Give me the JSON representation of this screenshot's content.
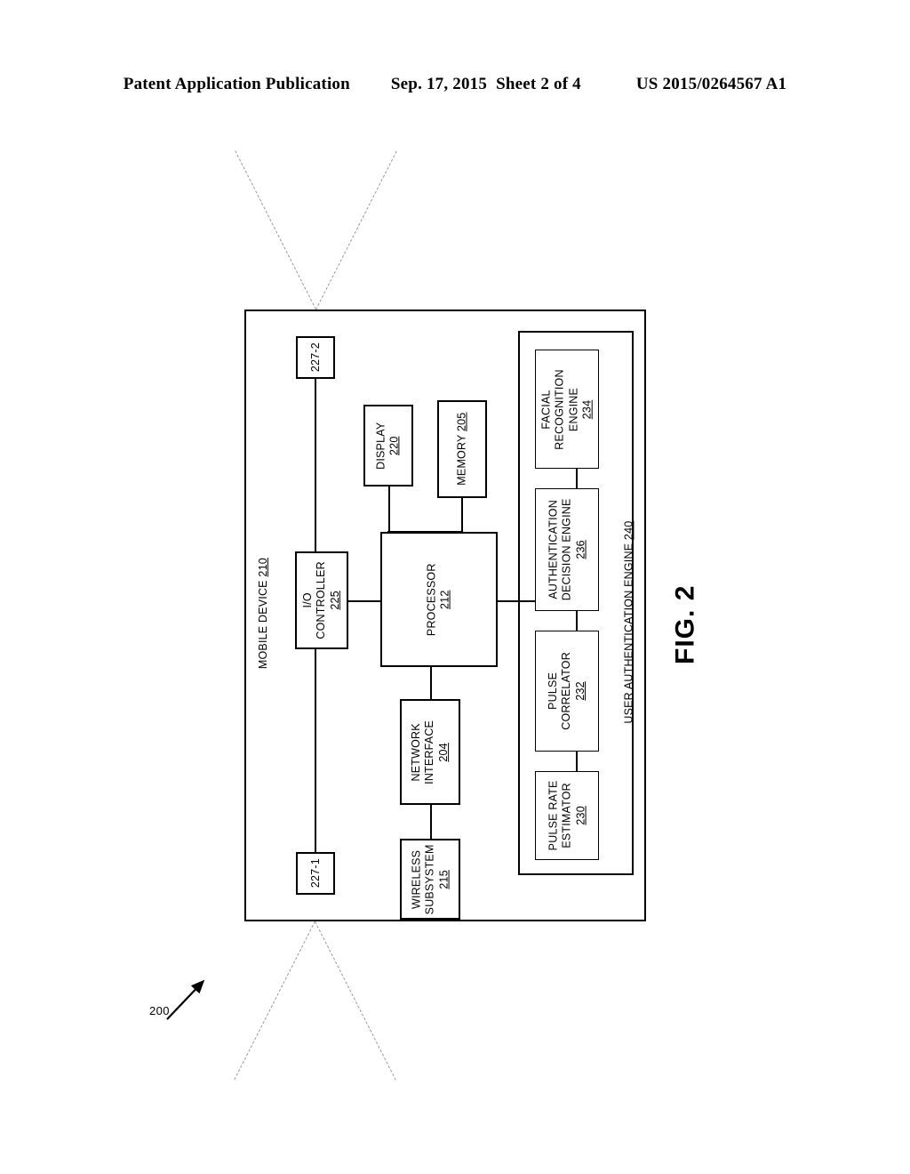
{
  "header": {
    "publication": "Patent Application Publication",
    "date": "Sep. 17, 2015",
    "sheet": "Sheet 2 of 4",
    "patent_number": "US 2015/0264567 A1"
  },
  "figure": {
    "caption": "FIG. 2",
    "reference_numeral": "200",
    "arrow_icon": "arrow-up-right-icon"
  },
  "diagram": {
    "outer_container": {
      "name": "mobile-device",
      "label": "MOBILE DEVICE",
      "numeral": "210"
    },
    "inner_container": {
      "name": "user-authentication-engine",
      "label": "USER AUTHENTICATION ENGINE",
      "numeral": "240"
    },
    "blocks": [
      {
        "id": "antenna-227-2",
        "label": "",
        "numeral": "227-2"
      },
      {
        "id": "antenna-227-1",
        "label": "",
        "numeral": "227-1"
      },
      {
        "id": "display",
        "label": "DISPLAY",
        "numeral": "220"
      },
      {
        "id": "memory",
        "label": "MEMORY",
        "numeral": "205",
        "inline_numeral": true
      },
      {
        "id": "io-controller",
        "label_line1": "I/O",
        "label_line2": "CONTROLLER",
        "numeral": "225"
      },
      {
        "id": "processor",
        "label": "PROCESSOR",
        "numeral": "212"
      },
      {
        "id": "network-interface",
        "label_line1": "NETWORK",
        "label_line2": "INTERFACE",
        "numeral": "204"
      },
      {
        "id": "wireless-subsystem",
        "label_line1": "WIRELESS",
        "label_line2": "SUBSYSTEM",
        "numeral": "215"
      },
      {
        "id": "facial-recognition-engine",
        "label_line1": "FACIAL",
        "label_line2": "RECOGNITION",
        "label_line3": "ENGINE",
        "numeral": "234"
      },
      {
        "id": "authentication-decision-engine",
        "label_line1": "AUTHENTICATION",
        "label_line2": "DECISION ENGINE",
        "numeral": "236"
      },
      {
        "id": "pulse-correlator",
        "label_line1": "PULSE",
        "label_line2": "CORRELATOR",
        "numeral": "232"
      },
      {
        "id": "pulse-rate-estimator",
        "label_line1": "PULSE RATE",
        "label_line2": "ESTIMATOR",
        "numeral": "230"
      }
    ]
  },
  "colors": {
    "ink": "#000000",
    "antenna_dash": "#9a9a9a",
    "background": "#ffffff"
  }
}
